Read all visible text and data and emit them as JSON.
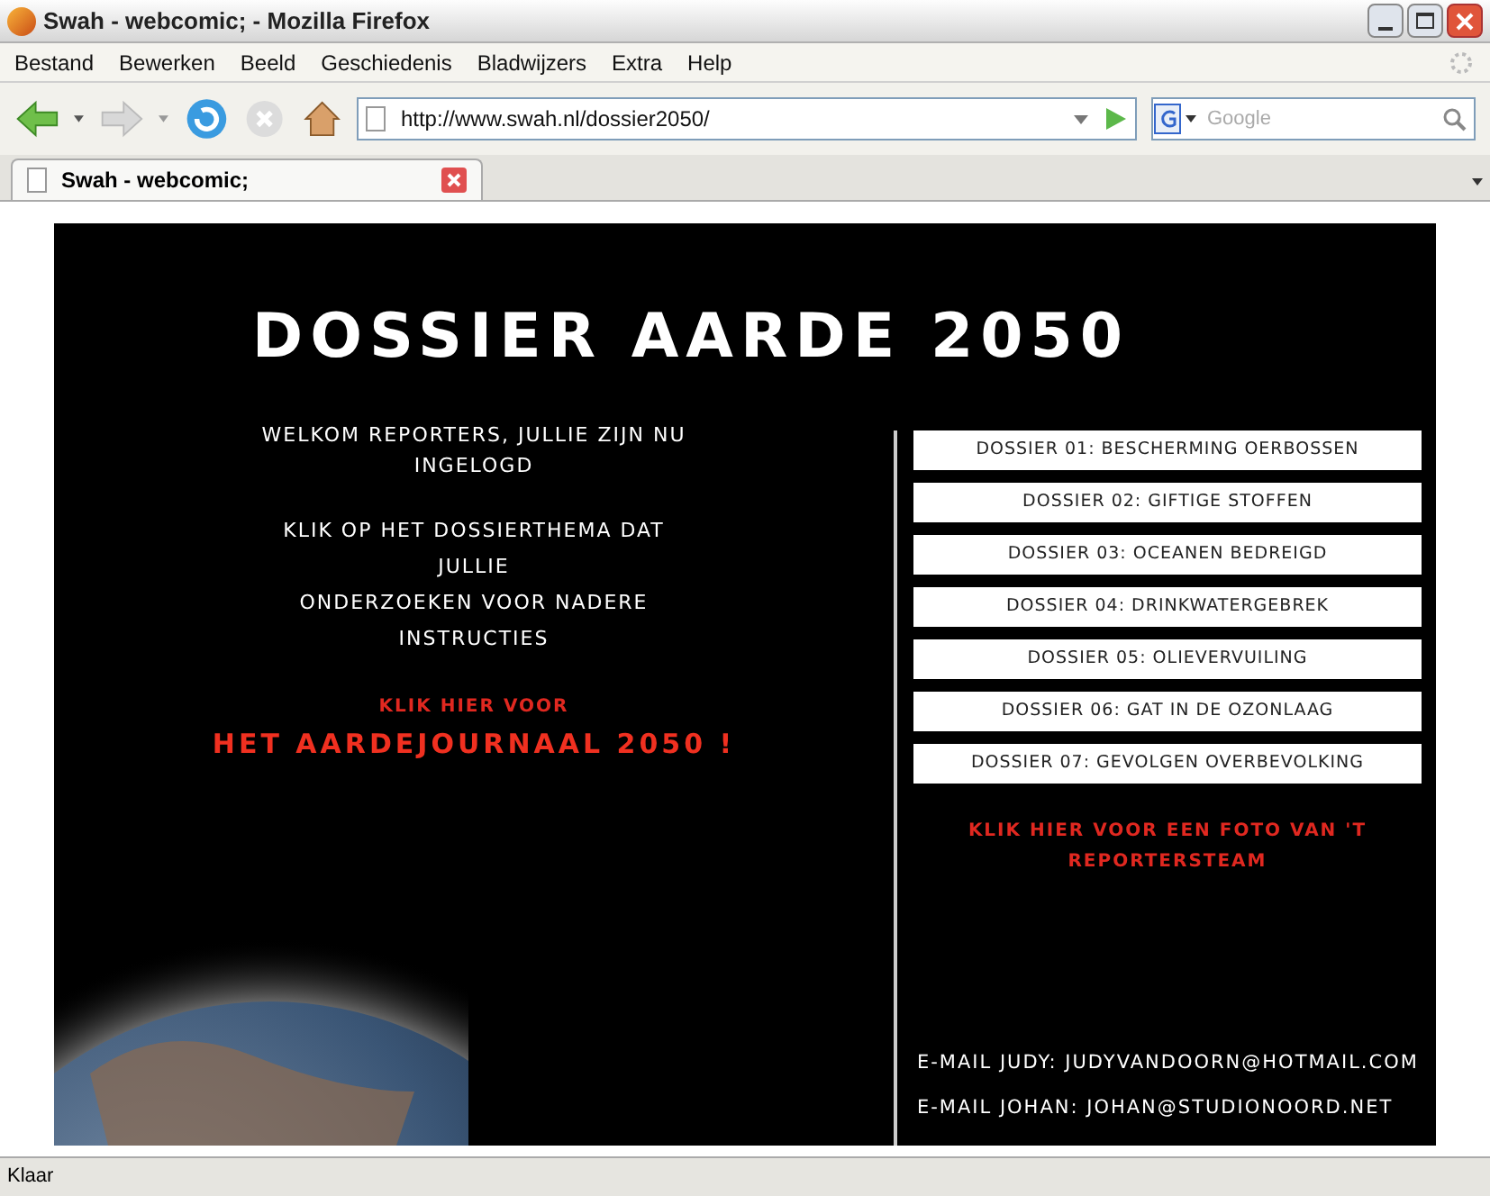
{
  "window": {
    "title": "Swah - webcomic; - Mozilla Firefox"
  },
  "menu": [
    "Bestand",
    "Bewerken",
    "Beeld",
    "Geschiedenis",
    "Bladwijzers",
    "Extra",
    "Help"
  ],
  "toolbar": {
    "url": "http://www.swah.nl/dossier2050/",
    "search_placeholder": "Google"
  },
  "tabs": [
    {
      "label": "Swah - webcomic;",
      "selected": true
    }
  ],
  "page": {
    "title": "DOSSIER AARDE 2050",
    "welcome": "WELKOM REPORTERS, JULLIE ZIJN NU INGELOGD",
    "instructions": [
      "KLIK OP HET DOSSIERTHEMA DAT",
      "JULLIE",
      "ONDERZOEKEN VOOR NADERE",
      "INSTRUCTIES"
    ],
    "journal_link_small": "KLIK HIER VOOR",
    "journal_link_large": "HET AARDEJOURNAAL 2050 !",
    "dossiers": [
      "DOSSIER 01: BESCHERMING OERBOSSEN",
      "DOSSIER 02: GIFTIGE STOFFEN",
      "DOSSIER 03: OCEANEN BEDREIGD",
      "DOSSIER 04: DRINKWATERGEBREK",
      "DOSSIER 05: OLIEVERVUILING",
      "DOSSIER 06: GAT IN DE OZONLAAG",
      "DOSSIER 07: GEVOLGEN OVERBEVOLKING"
    ],
    "team_link": "KLIK HIER VOOR EEN FOTO VAN 'T REPORTERSTEAM",
    "emails": [
      "E-MAIL JUDY: JUDYVANDOORN@HOTMAIL.COM",
      "E-MAIL JOHAN: JOHAN@STUDIONOORD.NET"
    ]
  },
  "status_bar": "Klaar"
}
